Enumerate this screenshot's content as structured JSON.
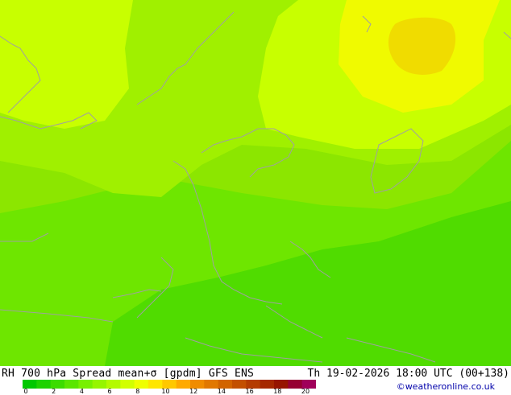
{
  "header": {
    "title": "RH 700 hPa Spread mean+σ [gpdm] GFS ENS",
    "valid": "Th 19-02-2026 18:00 UTC (00+138)",
    "credit": "©weatheronline.co.uk"
  },
  "legend": {
    "tick_labels": [
      "0",
      "2",
      "4",
      "6",
      "8",
      "10",
      "12",
      "14",
      "16",
      "18",
      "20"
    ],
    "colors": [
      "#00c800",
      "#1ed200",
      "#3cdc00",
      "#5ae600",
      "#78f000",
      "#96f500",
      "#b4fa00",
      "#d2ff00",
      "#f0ff00",
      "#ffe600",
      "#ffc800",
      "#ffaa00",
      "#f08c00",
      "#e17800",
      "#d26400",
      "#c35000",
      "#b43c00",
      "#a52800",
      "#961400",
      "#960032",
      "#a0005a"
    ]
  },
  "map": {
    "fill_colors": {
      "band_2_3": "#50dc00",
      "band_3_4": "#6ee600",
      "band_4_5": "#8ce600",
      "band_5_6": "#a0f000",
      "band_6_7": "#c8ff00",
      "band_7_8": "#f0fa00",
      "band_8_9": "#f0dc00"
    },
    "coast_color": "#a0a0a0"
  }
}
